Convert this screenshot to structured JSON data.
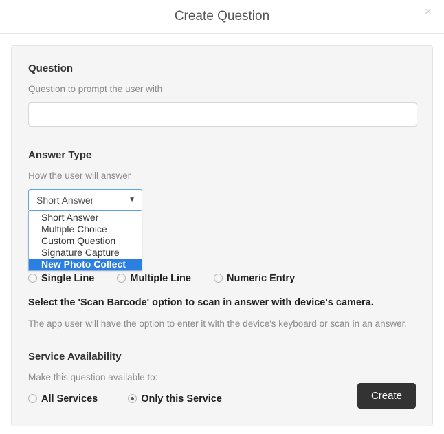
{
  "modal": {
    "title": "Create Question",
    "close_icon": "close-icon",
    "close_glyph": "×"
  },
  "question_section": {
    "heading": "Question",
    "help": "Question to prompt the user with",
    "input_value": "",
    "input_placeholder": ""
  },
  "answer_type_section": {
    "heading": "Answer Type",
    "help": "How the user will answer",
    "select": {
      "value": "Short Answer",
      "arrow_icon": "chevron-down-icon",
      "arrow_glyph": "▼",
      "open": true,
      "options": [
        {
          "label": "Short Answer",
          "selected": false
        },
        {
          "label": "Multiple Choice",
          "selected": false
        },
        {
          "label": "Custom Question",
          "selected": false
        },
        {
          "label": "Signature Capture",
          "selected": false
        },
        {
          "label": "New Photo Collect",
          "selected": true
        }
      ]
    },
    "format_radios": [
      {
        "label": "Single Line",
        "checked": false
      },
      {
        "label": "Multiple Line",
        "checked": false
      },
      {
        "label": "Numeric Entry",
        "checked": false
      }
    ],
    "bold_note": "Select the 'Scan Barcode' option to scan in answer with device's camera.",
    "sub_note": "The app user will have the option to enter it with the device's keyboard or scan in an answer."
  },
  "service_availability_section": {
    "heading": "Service Availability",
    "help": "Make this question available to:",
    "radios": [
      {
        "label": "All Services",
        "checked": false
      },
      {
        "label": "Only this Service",
        "checked": true
      }
    ]
  },
  "footer": {
    "create_label": "Create"
  },
  "colors": {
    "accent_blue": "#2a7fe0",
    "focus_border": "#5ba4e5",
    "panel_bg": "#f5f5f5",
    "button_dark": "#333333",
    "muted_text": "#8a8a8a"
  }
}
